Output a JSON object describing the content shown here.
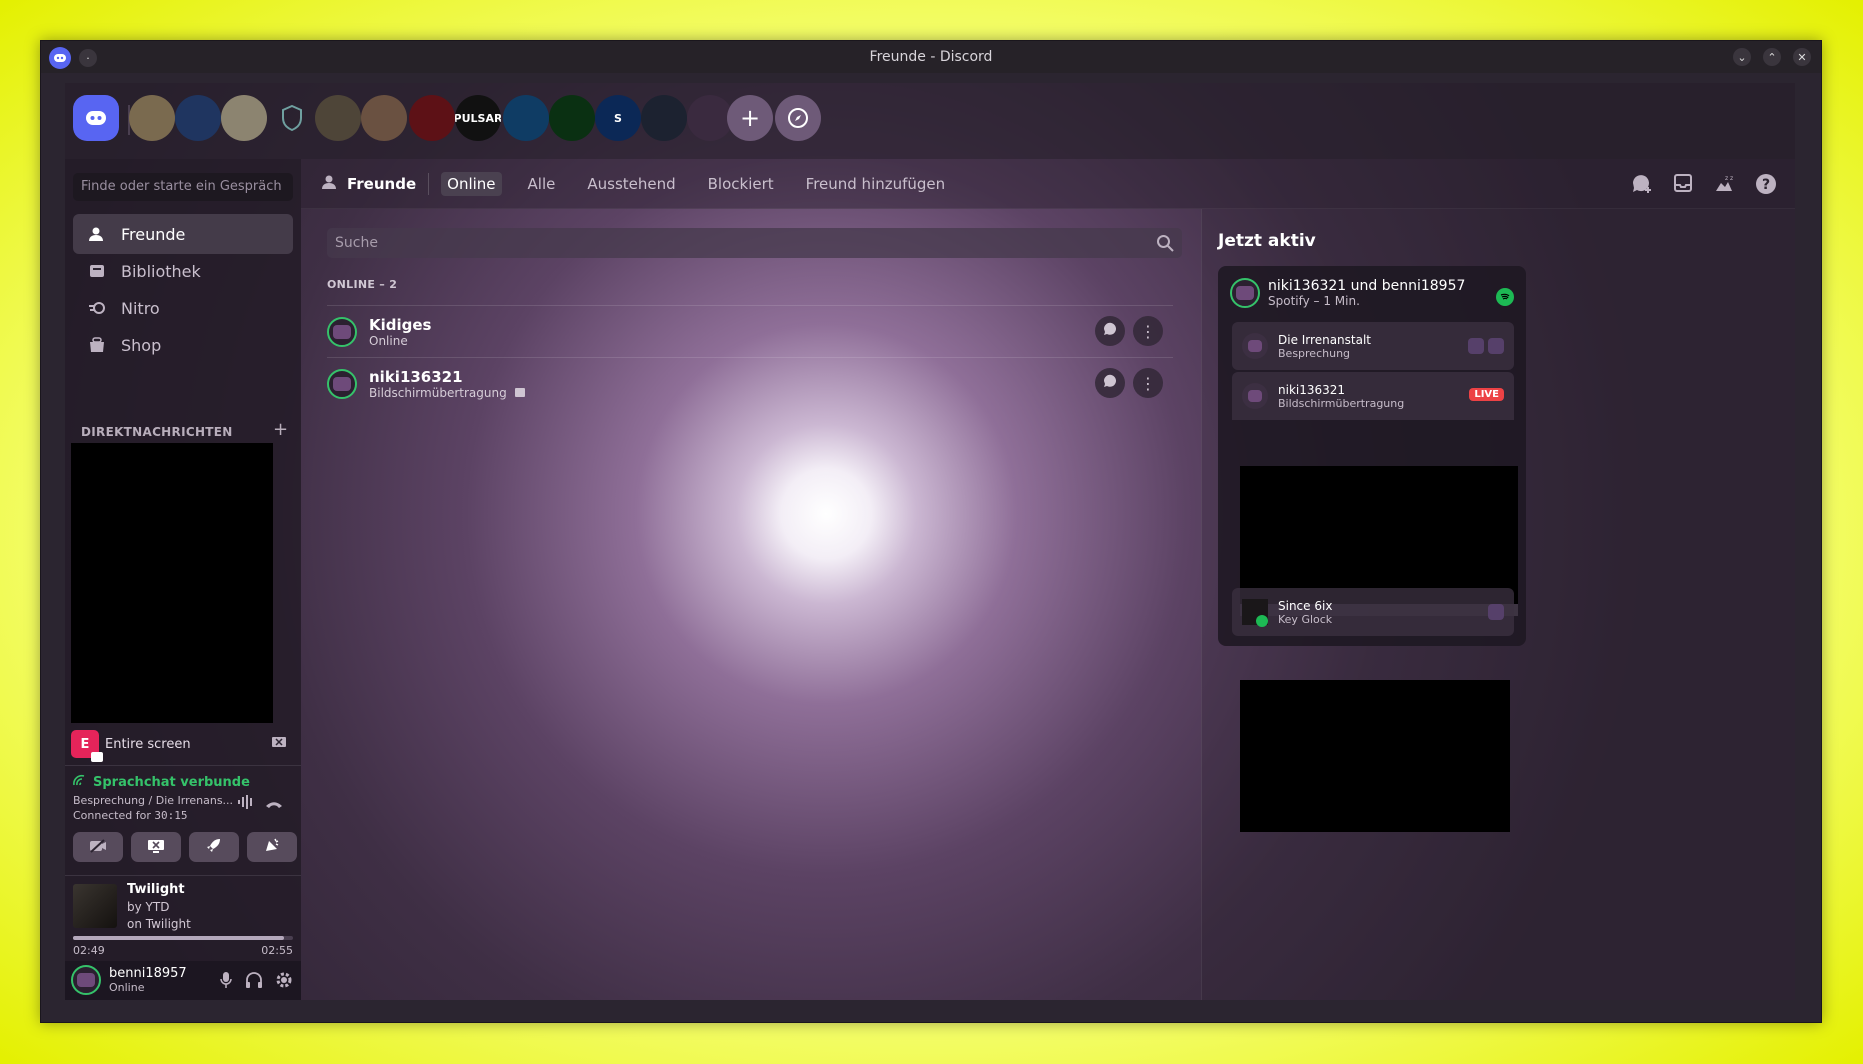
{
  "window": {
    "title": "Freunde - Discord"
  },
  "servers": [
    {
      "name": "discord-home",
      "label": "",
      "color": "#5865f2"
    },
    {
      "name": "server-1",
      "label": "",
      "color": "#7a6a4f"
    },
    {
      "name": "server-2",
      "label": "",
      "color": "#1f3560"
    },
    {
      "name": "server-3",
      "label": "",
      "color": "#8c8470"
    },
    {
      "name": "server-4",
      "label": "",
      "color": "#2a3a3a"
    },
    {
      "name": "server-5",
      "label": "",
      "color": "#4e4538"
    },
    {
      "name": "server-6",
      "label": "",
      "color": "#6a5141"
    },
    {
      "name": "server-7",
      "label": "",
      "color": "#5d1116"
    },
    {
      "name": "server-pulsar",
      "label": "PULSAR",
      "color": "#111111"
    },
    {
      "name": "server-9",
      "label": "",
      "color": "#0f3c64"
    },
    {
      "name": "server-10",
      "label": "",
      "color": "#0a3012"
    },
    {
      "name": "server-11",
      "label": "S",
      "color": "#0b2856"
    },
    {
      "name": "server-12",
      "label": "",
      "color": "#1c2230"
    },
    {
      "name": "server-13",
      "label": "",
      "color": "#3a2a3f"
    }
  ],
  "sidebar": {
    "search_placeholder": "Finde oder starte ein Gespräch",
    "nav": [
      {
        "label": "Freunde",
        "icon": "friends-icon"
      },
      {
        "label": "Bibliothek",
        "icon": "library-icon"
      },
      {
        "label": "Nitro",
        "icon": "nitro-icon"
      },
      {
        "label": "Shop",
        "icon": "shop-icon"
      }
    ],
    "dm_header": "DIREKTNACHRICHTEN",
    "dm_plus": "+"
  },
  "screen_share": {
    "badge": "E",
    "label": "Entire screen"
  },
  "voice": {
    "status": "Sprachchat verbunde",
    "channel": "Besprechung / Die Irrenans...",
    "connected_prefix": "Connected for",
    "connected_time": "30:15"
  },
  "music": {
    "title": "Twilight",
    "artist": "by YTD",
    "album": "on Twilight",
    "elapsed": "02:49",
    "total": "02:55",
    "progress_fraction": 0.96
  },
  "user": {
    "name": "benni18957",
    "status": "Online"
  },
  "topnav": {
    "title": "Freunde",
    "tabs": [
      {
        "label": "Online",
        "active": true
      },
      {
        "label": "Alle",
        "active": false
      },
      {
        "label": "Ausstehend",
        "active": false
      },
      {
        "label": "Blockiert",
        "active": false
      },
      {
        "label": "Freund hinzufügen",
        "active": false
      }
    ]
  },
  "main": {
    "search_placeholder": "Suche",
    "online_label": "ONLINE – 2",
    "friends": [
      {
        "name": "Kidiges",
        "status": "Online"
      },
      {
        "name": "niki136321",
        "status": "Bildschirmübertragung"
      }
    ]
  },
  "active_now": {
    "title": "Jetzt aktiv",
    "card": {
      "name": "niki136321 und benni18957",
      "sub": "Spotify – 1 Min.",
      "items": [
        {
          "name": "Die Irrenanstalt",
          "sub": "Besprechung"
        },
        {
          "name": "niki136321",
          "sub": "Bildschirmübertragung",
          "badge": "LIVE"
        },
        {
          "name": "Since 6ix",
          "sub": "Key Glock"
        }
      ]
    }
  },
  "colors": {
    "accent": "#5865f2",
    "green": "#35c26a",
    "live": "#ed4245",
    "spotify": "#1db954"
  }
}
